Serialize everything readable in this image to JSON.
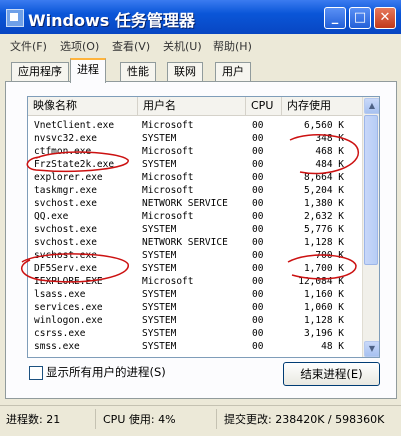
{
  "window": {
    "title": "Windows 任务管理器"
  },
  "menu": [
    "文件(F)",
    "选项(O)",
    "查看(V)",
    "关机(U)",
    "帮助(H)"
  ],
  "tabs": [
    "应用程序",
    "进程",
    "性能",
    "联网",
    "用户"
  ],
  "columns": [
    "映像名称",
    "用户名",
    "CPU",
    "内存使用"
  ],
  "processes": [
    {
      "name": "VnetClient.exe",
      "user": "Microsoft",
      "cpu": "00",
      "mem": "6,560 K"
    },
    {
      "name": "nvsvc32.exe",
      "user": "SYSTEM",
      "cpu": "00",
      "mem": "348 K"
    },
    {
      "name": "ctfmon.exe",
      "user": "Microsoft",
      "cpu": "00",
      "mem": "468 K"
    },
    {
      "name": "FrzState2k.exe",
      "user": "SYSTEM",
      "cpu": "00",
      "mem": "484 K"
    },
    {
      "name": "explorer.exe",
      "user": "Microsoft",
      "cpu": "00",
      "mem": "8,664 K"
    },
    {
      "name": "taskmgr.exe",
      "user": "Microsoft",
      "cpu": "00",
      "mem": "5,204 K"
    },
    {
      "name": "svchost.exe",
      "user": "NETWORK SERVICE",
      "cpu": "00",
      "mem": "1,380 K"
    },
    {
      "name": "QQ.exe",
      "user": "Microsoft",
      "cpu": "00",
      "mem": "2,632 K"
    },
    {
      "name": "svchost.exe",
      "user": "SYSTEM",
      "cpu": "00",
      "mem": "5,776 K"
    },
    {
      "name": "svchost.exe",
      "user": "NETWORK SERVICE",
      "cpu": "00",
      "mem": "1,128 K"
    },
    {
      "name": "svchost.exe",
      "user": "SYSTEM",
      "cpu": "00",
      "mem": "700 K"
    },
    {
      "name": "DF5Serv.exe",
      "user": "SYSTEM",
      "cpu": "00",
      "mem": "1,700 K"
    },
    {
      "name": "IEXPLORE.EXE",
      "user": "Microsoft",
      "cpu": "00",
      "mem": "12,084 K"
    },
    {
      "name": "lsass.exe",
      "user": "SYSTEM",
      "cpu": "00",
      "mem": "1,160 K"
    },
    {
      "name": "services.exe",
      "user": "SYSTEM",
      "cpu": "00",
      "mem": "1,060 K"
    },
    {
      "name": "winlogon.exe",
      "user": "SYSTEM",
      "cpu": "00",
      "mem": "1,128 K"
    },
    {
      "name": "csrss.exe",
      "user": "SYSTEM",
      "cpu": "00",
      "mem": "3,196 K"
    },
    {
      "name": "smss.exe",
      "user": "SYSTEM",
      "cpu": "00",
      "mem": "48 K"
    }
  ],
  "show_all_users_label": "显示所有用户的进程(S)",
  "end_process_label": "结束进程(E)",
  "status": {
    "processes": "进程数: 21",
    "cpu": "CPU 使用: 4%",
    "commit": "提交更改: 238420K / 598360K"
  }
}
